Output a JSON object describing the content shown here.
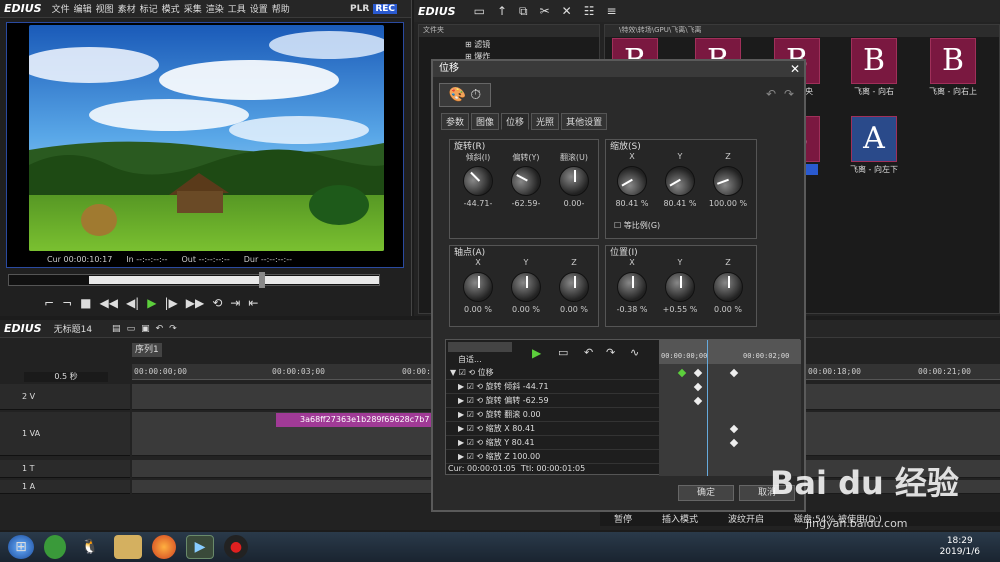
{
  "player": {
    "logo": "EDIUS",
    "menu": [
      "文件",
      "编辑",
      "视图",
      "素材",
      "标记",
      "模式",
      "采集",
      "渲染",
      "工具",
      "设置",
      "帮助"
    ],
    "plr": "PLR",
    "rec": "REC",
    "timecodes": [
      {
        "label": "Cur",
        "value": "00:00:10:17"
      },
      {
        "label": "In",
        "value": "--:--:--:--"
      },
      {
        "label": "Out",
        "value": "--:--:--:--"
      },
      {
        "label": "Dur",
        "value": "--:--:--:--"
      }
    ]
  },
  "bin": {
    "logo": "EDIUS",
    "tree_header": "文件夹",
    "tree_items": [
      "滤镜",
      "爆炸"
    ],
    "path": "\\特效\\转场\\GPU\\飞离\\飞离",
    "thumbs": [
      {
        "letter": "B",
        "label": "中央"
      },
      {
        "letter": "B",
        "label": "飞离 - 向右"
      },
      {
        "letter": "B",
        "label": "飞离 - 向右上"
      },
      {
        "letter": "A",
        "label": "左上"
      },
      {
        "letter": "A",
        "label": "飞离 - 向左下"
      }
    ]
  },
  "timeline": {
    "logo": "EDIUS",
    "project": "无标题14",
    "sequence": "序列1",
    "zoom": "0.5 秒",
    "ruler": [
      "00:00:00;00",
      "00:00:03;00",
      "00:00:06;00",
      "00:00:18;00",
      "00:00:21;00"
    ],
    "tracks": [
      {
        "name": "2 V"
      },
      {
        "name": "1 VA"
      },
      {
        "name": "1 T"
      },
      {
        "name": "1 A"
      }
    ],
    "clip": "3a68ff27363e1b289f69628c7b7"
  },
  "dialog": {
    "title": "位移",
    "tabs": [
      "参数",
      "图像",
      "位移",
      "光照",
      "其他设置"
    ],
    "active_tab": "位移",
    "rotation": {
      "label": "旋转(R)",
      "knobs": [
        {
          "label": "倾斜(I)",
          "value": "-44.71-"
        },
        {
          "label": "偏转(Y)",
          "value": "-62.59-"
        },
        {
          "label": "翻滚(U)",
          "value": "0.00-"
        }
      ]
    },
    "scale": {
      "label": "缩放(S)",
      "knobs": [
        {
          "label": "X",
          "value": "80.41 %"
        },
        {
          "label": "Y",
          "value": "80.41 %"
        },
        {
          "label": "Z",
          "value": "100.00 %"
        }
      ],
      "proportional": "等比例(G)"
    },
    "anchor": {
      "label": "轴点(A)",
      "knobs": [
        {
          "label": "X",
          "value": "0.00 %"
        },
        {
          "label": "Y",
          "value": "0.00 %"
        },
        {
          "label": "Z",
          "value": "0.00 %"
        }
      ]
    },
    "position": {
      "label": "位置(I)",
      "knobs": [
        {
          "label": "X",
          "value": "-0.38 %"
        },
        {
          "label": "Y",
          "value": "+0.55 %"
        },
        {
          "label": "Z",
          "value": "0.00 %"
        }
      ]
    },
    "kf_mode": "自适...",
    "kf_ruler": [
      "00:00:00;00",
      "00:00:02;00"
    ],
    "kf_rows": [
      "位移",
      "旋转 倾斜 -44.71",
      "旋转 偏转 -62.59",
      "旋转 翻滚 0.00",
      "缩放 X 80.41",
      "缩放 Y 80.41",
      "缩放 Z 100.00"
    ],
    "kf_status": "Cur: 00:00:01:05  Ttl: 00:00:01:05",
    "ok": "确定",
    "cancel": "取消"
  },
  "status": {
    "items": [
      "暂停",
      "插入模式",
      "波纹开启",
      "磁盘:54% 被使用(D:)"
    ]
  },
  "taskbar": {
    "time": "18:29",
    "date": "2019/1/6"
  },
  "watermark": {
    "text": "Bai du 经验",
    "url": "jingyan.baidu.com"
  }
}
